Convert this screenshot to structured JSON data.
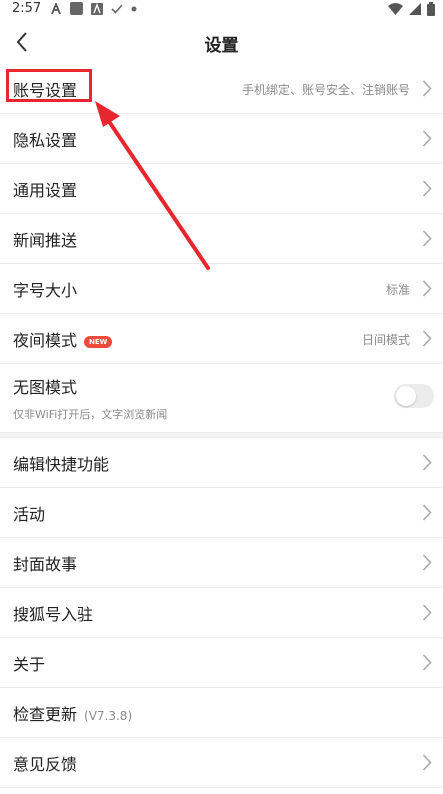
{
  "status_bar": {
    "time": "2:57",
    "left_icons": [
      "notification-a-icon",
      "app-square-icon",
      "app-a-icon",
      "check-icon",
      "dot-icon"
    ],
    "right_icons": [
      "wifi-icon",
      "signal-icon",
      "battery-icon"
    ]
  },
  "nav": {
    "title": "设置",
    "back_icon": "chevron-left-icon"
  },
  "settings": {
    "account": {
      "label": "账号设置",
      "hint": "手机绑定、账号安全、注销账号"
    },
    "privacy": {
      "label": "隐私设置"
    },
    "general": {
      "label": "通用设置"
    },
    "news_push": {
      "label": "新闻推送"
    },
    "font_size": {
      "label": "字号大小",
      "hint": "标准"
    },
    "night_mode": {
      "label": "夜间模式",
      "badge": "NEW",
      "hint": "日间模式"
    },
    "no_image": {
      "label": "无图模式",
      "sub": "仅非WiFi打开后，文字浏览新闻",
      "enabled": false
    },
    "edit_shortcuts": {
      "label": "编辑快捷功能"
    },
    "activity": {
      "label": "活动"
    },
    "cover_story": {
      "label": "封面故事"
    },
    "sohu_account": {
      "label": "搜狐号入驻"
    },
    "about": {
      "label": "关于"
    },
    "check_update": {
      "label": "检查更新",
      "version": "(V7.3.8)"
    },
    "feedback": {
      "label": "意见反馈"
    }
  },
  "annotation": {
    "highlight_color": "#e8262e",
    "target": "account"
  },
  "colors": {
    "badge": "#f04a3a",
    "text": "#222222",
    "hint": "#8a8a8a",
    "divider": "#ececec"
  }
}
